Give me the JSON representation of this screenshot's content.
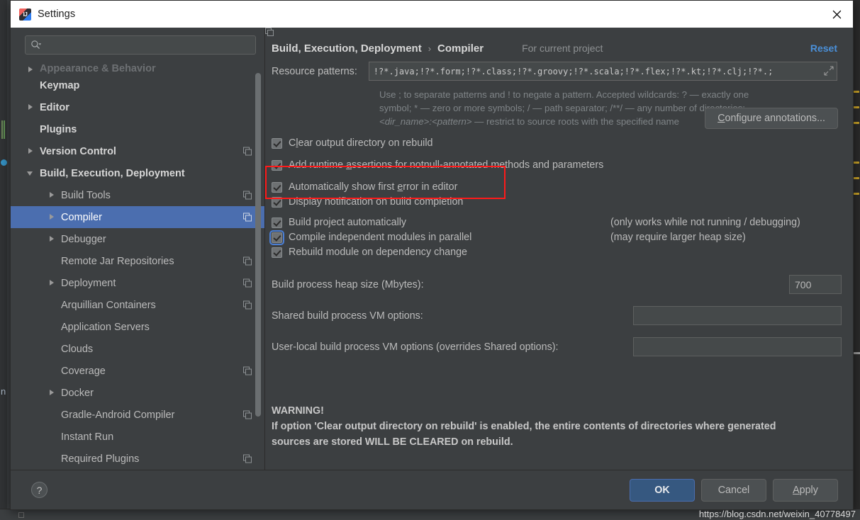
{
  "window": {
    "title": "Settings",
    "app_icon": "intellij-idea-icon",
    "close_icon": "close-icon"
  },
  "sidebar": {
    "search": {
      "placeholder": "",
      "value": "",
      "icon": "search-icon"
    },
    "items": [
      {
        "label": "Appearance & Behavior",
        "indent": 0,
        "twisty": "collapsed",
        "bold": true,
        "clipped": true,
        "copy": false,
        "selected": false
      },
      {
        "label": "Keymap",
        "indent": 0,
        "twisty": "none",
        "bold": true,
        "clipped": false,
        "copy": false,
        "selected": false
      },
      {
        "label": "Editor",
        "indent": 0,
        "twisty": "collapsed",
        "bold": true,
        "clipped": false,
        "copy": false,
        "selected": false
      },
      {
        "label": "Plugins",
        "indent": 0,
        "twisty": "none",
        "bold": true,
        "clipped": false,
        "copy": false,
        "selected": false
      },
      {
        "label": "Version Control",
        "indent": 0,
        "twisty": "collapsed",
        "bold": true,
        "clipped": false,
        "copy": true,
        "selected": false
      },
      {
        "label": "Build, Execution, Deployment",
        "indent": 0,
        "twisty": "expanded",
        "bold": true,
        "clipped": false,
        "copy": false,
        "selected": false
      },
      {
        "label": "Build Tools",
        "indent": 1,
        "twisty": "collapsed",
        "bold": false,
        "clipped": false,
        "copy": true,
        "selected": false
      },
      {
        "label": "Compiler",
        "indent": 1,
        "twisty": "collapsed",
        "bold": false,
        "clipped": false,
        "copy": true,
        "selected": true
      },
      {
        "label": "Debugger",
        "indent": 1,
        "twisty": "collapsed",
        "bold": false,
        "clipped": false,
        "copy": false,
        "selected": false
      },
      {
        "label": "Remote Jar Repositories",
        "indent": 1,
        "twisty": "none",
        "bold": false,
        "clipped": false,
        "copy": true,
        "selected": false
      },
      {
        "label": "Deployment",
        "indent": 1,
        "twisty": "collapsed",
        "bold": false,
        "clipped": false,
        "copy": true,
        "selected": false
      },
      {
        "label": "Arquillian Containers",
        "indent": 1,
        "twisty": "none",
        "bold": false,
        "clipped": false,
        "copy": true,
        "selected": false
      },
      {
        "label": "Application Servers",
        "indent": 1,
        "twisty": "none",
        "bold": false,
        "clipped": false,
        "copy": false,
        "selected": false
      },
      {
        "label": "Clouds",
        "indent": 1,
        "twisty": "none",
        "bold": false,
        "clipped": false,
        "copy": false,
        "selected": false
      },
      {
        "label": "Coverage",
        "indent": 1,
        "twisty": "none",
        "bold": false,
        "clipped": false,
        "copy": true,
        "selected": false
      },
      {
        "label": "Docker",
        "indent": 1,
        "twisty": "collapsed",
        "bold": false,
        "clipped": false,
        "copy": false,
        "selected": false
      },
      {
        "label": "Gradle-Android Compiler",
        "indent": 1,
        "twisty": "none",
        "bold": false,
        "clipped": false,
        "copy": true,
        "selected": false
      },
      {
        "label": "Instant Run",
        "indent": 1,
        "twisty": "none",
        "bold": false,
        "clipped": false,
        "copy": false,
        "selected": false
      },
      {
        "label": "Required Plugins",
        "indent": 1,
        "twisty": "none",
        "bold": false,
        "clipped": false,
        "copy": true,
        "selected": false
      }
    ]
  },
  "header": {
    "breadcrumb_parent": "Build, Execution, Deployment",
    "breadcrumb_sep": "›",
    "breadcrumb_current": "Compiler",
    "scope_label": "For current project",
    "scope_icon": "copy-icon",
    "reset_label": "Reset"
  },
  "form": {
    "resource_patterns_label": "Resource patterns:",
    "resource_patterns_value": "!?*.java;!?*.form;!?*.class;!?*.groovy;!?*.scala;!?*.flex;!?*.kt;!?*.clj;!?*.;",
    "expand_icon": "expand-icon",
    "hint_line1": "Use ; to separate patterns and ! to negate a pattern. Accepted wildcards: ? — exactly one",
    "hint_line2": "symbol; * — zero or more symbols; / — path separator; /**/ — any number of directories;",
    "hint_line3_italic": "<dir_name>:<pattern>",
    "hint_line3_rest": " — restrict to source roots with the specified name",
    "checkboxes": [
      {
        "label_pre": "C",
        "label_mnemonic": "l",
        "label_post": "ear output directory on rebuild",
        "checked": true,
        "focused": false,
        "note": ""
      },
      {
        "label_pre": "Add runtime ",
        "label_mnemonic": "a",
        "label_post": "ssertions for notnull-annotated methods and parameters",
        "checked": true,
        "focused": false,
        "note": ""
      },
      {
        "label_pre": "Automatically show first ",
        "label_mnemonic": "e",
        "label_post": "rror in editor",
        "checked": true,
        "focused": false,
        "note": ""
      },
      {
        "label_pre": "Display notification on build completion",
        "label_mnemonic": "",
        "label_post": "",
        "checked": true,
        "focused": false,
        "note": ""
      },
      {
        "label_pre": "Build project automatically",
        "label_mnemonic": "",
        "label_post": "",
        "checked": true,
        "focused": false,
        "note": "(only works while not running / debugging)"
      },
      {
        "label_pre": "Compile independent modules in parallel",
        "label_mnemonic": "",
        "label_post": "",
        "checked": true,
        "focused": true,
        "note": "(may require larger heap size)"
      },
      {
        "label_pre": "Rebuild module on dependency change",
        "label_mnemonic": "",
        "label_post": "",
        "checked": true,
        "focused": false,
        "note": ""
      }
    ],
    "configure_annotations_pre": "C",
    "configure_annotations_mnemonic": "",
    "configure_annotations_label": "Configure annotations...",
    "heap_label": "Build process heap size (Mbytes):",
    "heap_value": "700",
    "shared_vm_label": "Shared build process VM options:",
    "shared_vm_value": "",
    "userlocal_vm_label": "User-local build process VM options (overrides Shared options):",
    "userlocal_vm_value": "",
    "warning_title": "WARNING!",
    "warning_line1": "If option 'Clear output directory on rebuild' is enabled, the entire contents of directories where generated",
    "warning_line2": "sources are stored WILL BE CLEARED on rebuild."
  },
  "footer": {
    "help_label": "?",
    "ok_label": "OK",
    "cancel_label": "Cancel",
    "apply_pre": "",
    "apply_mnemonic": "A",
    "apply_post": "pply"
  },
  "watermark": "https://blog.csdn.net/weixin_40778497",
  "colors": {
    "dialog_bg": "#3c3f41",
    "selection_blue": "#4b6eaf",
    "accent_link": "#4a90d9",
    "primary_button": "#365880",
    "highlight_red": "#ff1a1a",
    "text": "#bbbbbb",
    "titlebar_bg": "#ffffff"
  }
}
